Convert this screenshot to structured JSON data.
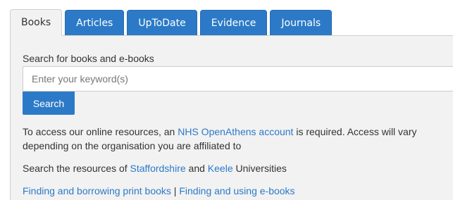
{
  "tabs": [
    {
      "label": "Books",
      "active": true
    },
    {
      "label": "Articles",
      "active": false
    },
    {
      "label": "UpToDate",
      "active": false
    },
    {
      "label": "Evidence",
      "active": false
    },
    {
      "label": "Journals",
      "active": false
    }
  ],
  "search": {
    "label": "Search for books and e-books",
    "placeholder": "Enter your keyword(s)",
    "button_label": "Search"
  },
  "access": {
    "text_before": "To access our online resources, an ",
    "link": "NHS OpenAthens account",
    "text_after": " is required. Access will vary depending on the organisation you are affiliated to"
  },
  "resources": {
    "text_before": "Search the resources of ",
    "link1": "Staffordshire",
    "text_middle": " and ",
    "link2": "Keele",
    "text_after": " Universities"
  },
  "footer_links": {
    "link1": "Finding and borrowing print books",
    "separator": " | ",
    "link2": "Finding and using e-books"
  },
  "colors": {
    "accent": "#2c7ac7",
    "panel_bg": "#f2f2f2"
  }
}
